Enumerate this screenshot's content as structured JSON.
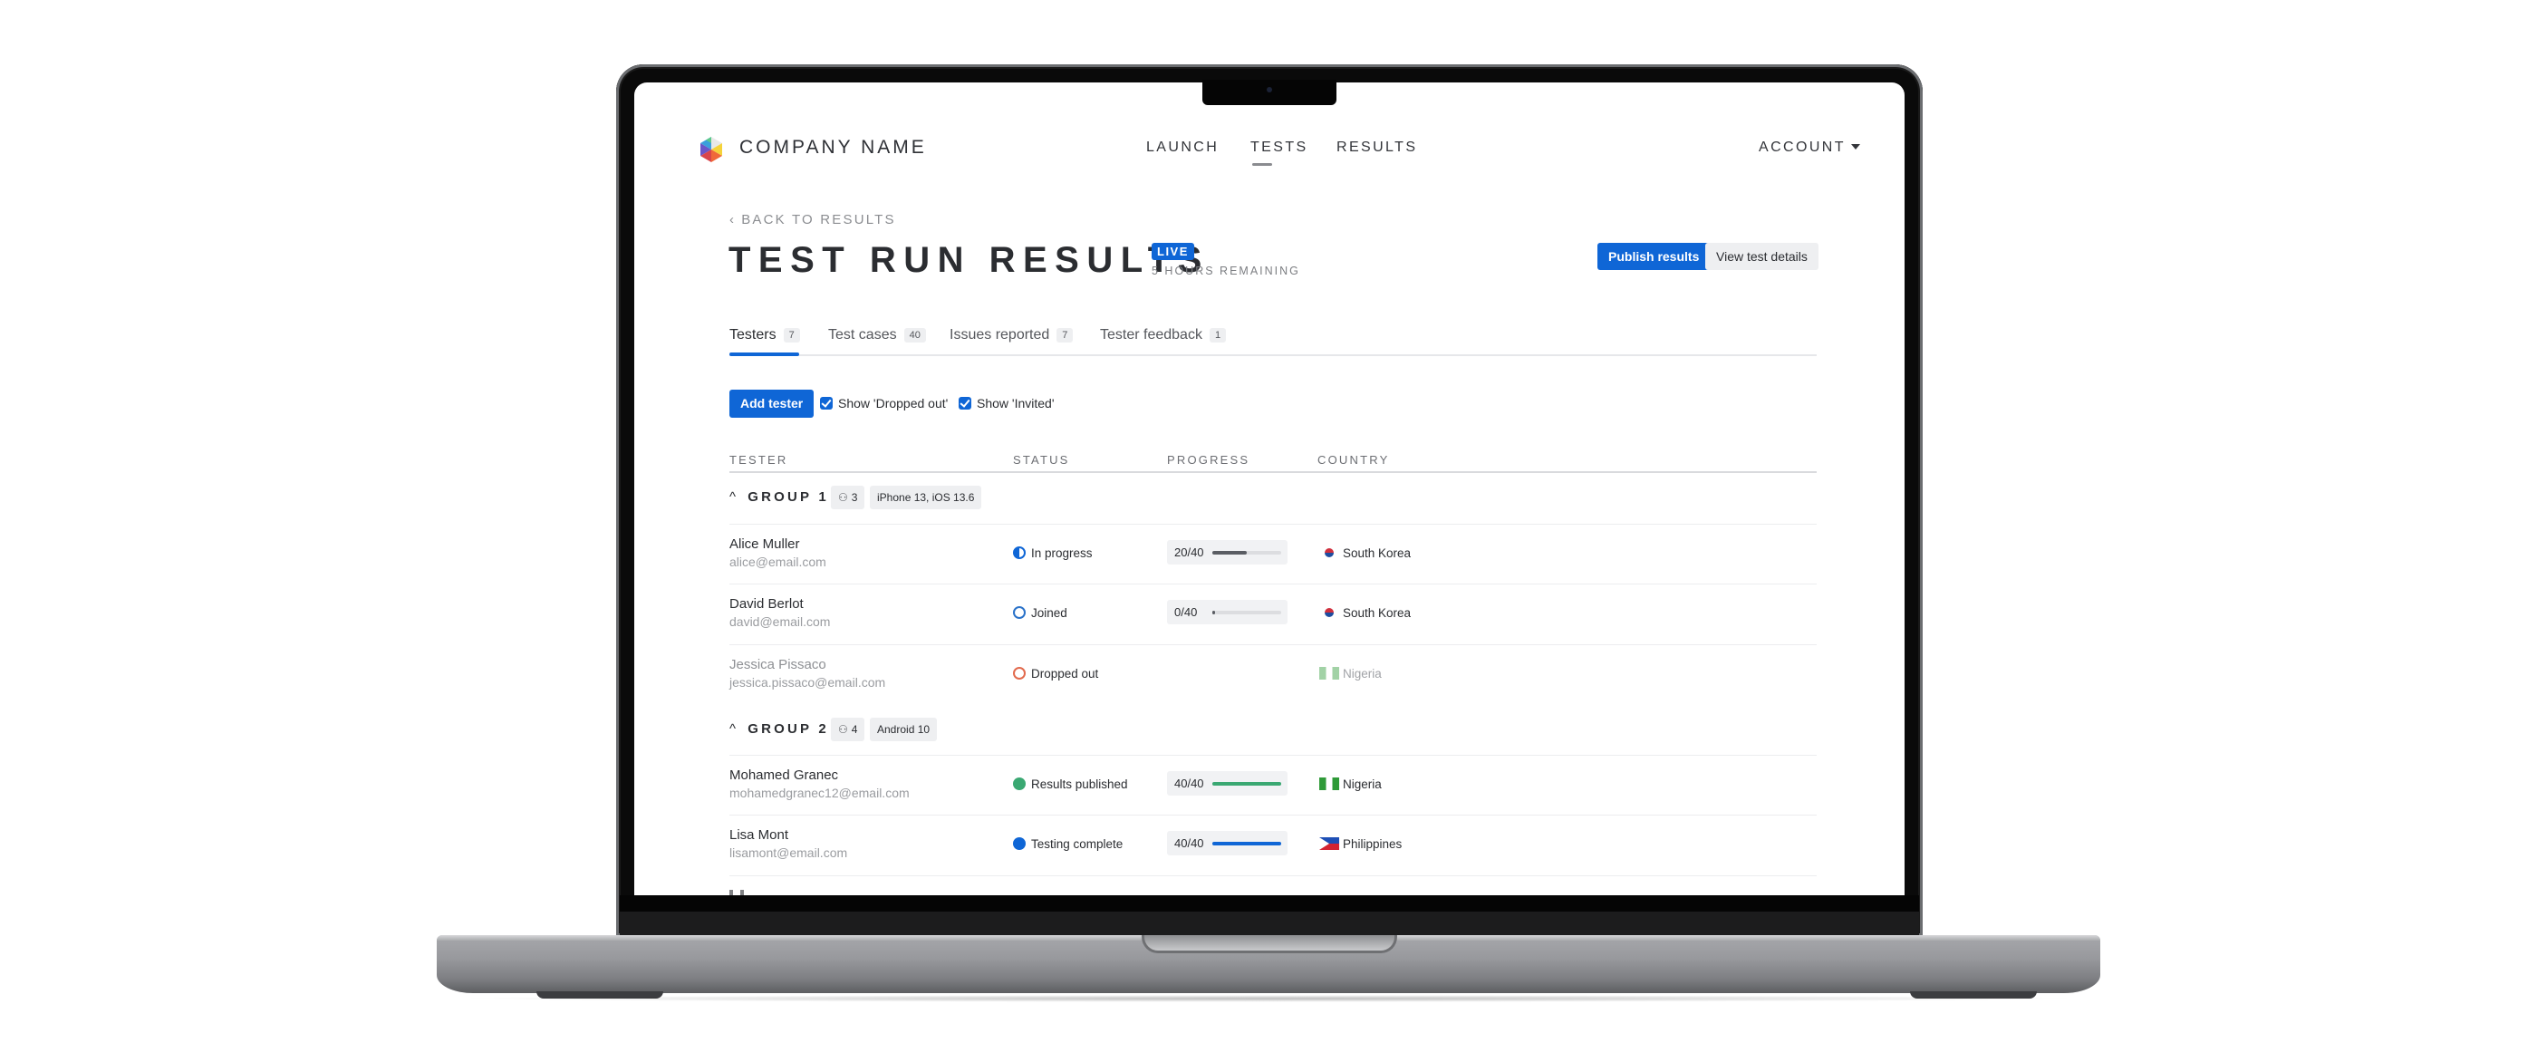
{
  "header": {
    "brand": "COMPANY NAME",
    "nav": [
      {
        "label": "LAUNCH",
        "active": false
      },
      {
        "label": "TESTS",
        "active": true
      },
      {
        "label": "RESULTS",
        "active": false
      }
    ],
    "account": "ACCOUNT"
  },
  "page": {
    "back_link": "BACK TO RESULTS",
    "title": "TEST RUN RESULTS",
    "live_badge": "LIVE",
    "remaining": "5 HOURS REMAINING",
    "publish_button": "Publish results",
    "details_button": "View test details"
  },
  "tabs": [
    {
      "label": "Testers",
      "count": "7",
      "active": true
    },
    {
      "label": "Test cases",
      "count": "40",
      "active": false
    },
    {
      "label": "Issues reported",
      "count": "7",
      "active": false
    },
    {
      "label": "Tester feedback",
      "count": "1",
      "active": false
    }
  ],
  "toolbar": {
    "add_tester": "Add tester",
    "filters": [
      {
        "label": "Show 'Dropped out'",
        "checked": true
      },
      {
        "label": "Show 'Invited'",
        "checked": true
      }
    ]
  },
  "table": {
    "columns": [
      "TESTER",
      "STATUS",
      "PROGRESS",
      "COUNTRY"
    ],
    "groups": [
      {
        "name": "GROUP 1",
        "members": "3",
        "device": "iPhone 13, iOS 13.6",
        "rows": [
          {
            "name": "Alice Muller",
            "email": "alice@email.com",
            "status": "In progress",
            "status_kind": "inprogress",
            "progress": "20/40",
            "progress_fraction": 0.5,
            "progress_color": "#5a5d63",
            "country": "South Korea",
            "flag": "kr",
            "muted": false
          },
          {
            "name": "David Berlot",
            "email": "david@email.com",
            "status": "Joined",
            "status_kind": "joined",
            "progress": "0/40",
            "progress_fraction": 0,
            "progress_color": "#5a5d63",
            "country": "South Korea",
            "flag": "kr",
            "muted": false
          },
          {
            "name": "Jessica Pissaco",
            "email": "jessica.pissaco@email.com",
            "status": "Dropped out",
            "status_kind": "dropped",
            "progress": null,
            "progress_fraction": null,
            "progress_color": null,
            "country": "Nigeria",
            "flag": "ng",
            "muted": true
          }
        ]
      },
      {
        "name": "GROUP 2",
        "members": "4",
        "device": "Android 10",
        "rows": [
          {
            "name": "Mohamed Granec",
            "email": "mohamedgranec12@email.com",
            "status": "Results published",
            "status_kind": "published",
            "progress": "40/40",
            "progress_fraction": 1,
            "progress_color": "#3aa872",
            "country": "Nigeria",
            "flag": "ng",
            "muted": false
          },
          {
            "name": "Lisa Mont",
            "email": "lisamont@email.com",
            "status": "Testing complete",
            "status_kind": "complete",
            "progress": "40/40",
            "progress_fraction": 1,
            "progress_color": "#0f66d6",
            "country": "Philippines",
            "flag": "ph",
            "muted": false
          }
        ]
      }
    ]
  },
  "colors": {
    "accent": "#0f66d6",
    "success": "#3aa872",
    "danger": "#e26a4d"
  }
}
